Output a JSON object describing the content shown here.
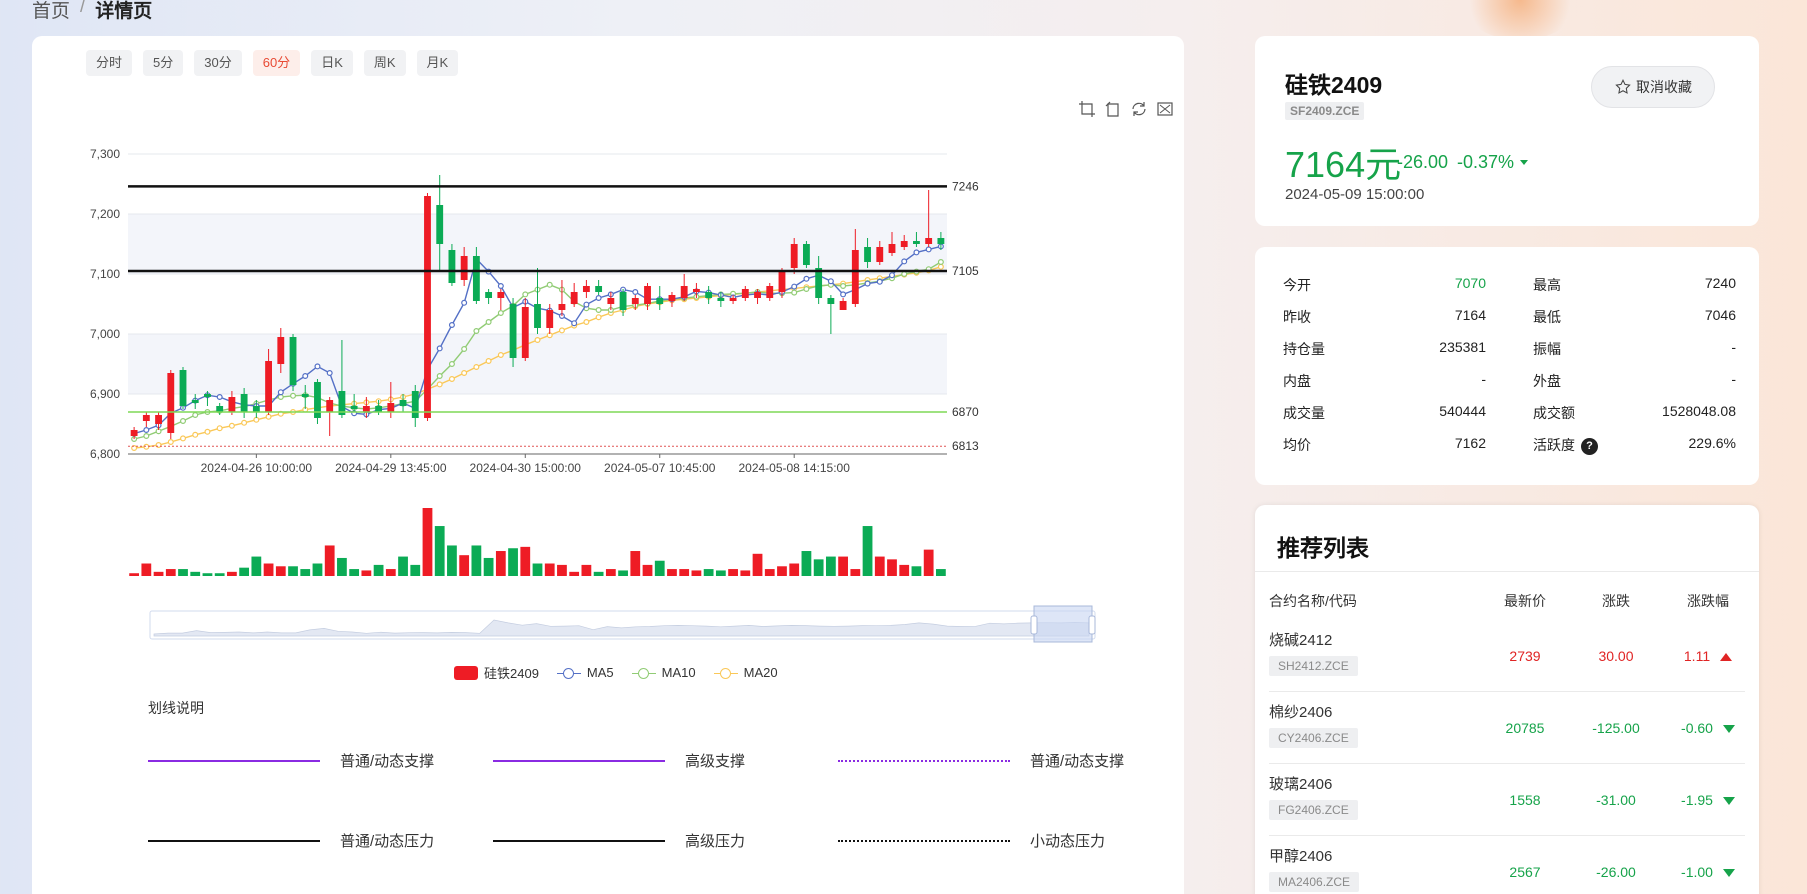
{
  "breadcrumb": {
    "home": "首页",
    "separator": "/",
    "current": "详情页"
  },
  "tabs": [
    {
      "label": "分时",
      "active": false
    },
    {
      "label": "5分",
      "active": false
    },
    {
      "label": "30分",
      "active": false
    },
    {
      "label": "60分",
      "active": true
    },
    {
      "label": "日K",
      "active": false
    },
    {
      "label": "周K",
      "active": false
    },
    {
      "label": "月K",
      "active": false
    }
  ],
  "toolbar_icons": [
    "crop-icon",
    "crop-undo-icon",
    "restore-icon",
    "fullscreen-icon"
  ],
  "quote": {
    "name": "硅铁2409",
    "code": "SF2409.ZCE",
    "price": "7164元",
    "change": "-26.00",
    "change_pct": "-0.37%",
    "time": "2024-05-09 15:00:00",
    "fav_label": "取消收藏"
  },
  "stats": {
    "left": [
      {
        "label": "今开",
        "value": "7070",
        "color": "#16a34a"
      },
      {
        "label": "昨收",
        "value": "7164"
      },
      {
        "label": "持仓量",
        "value": "235381"
      },
      {
        "label": "内盘",
        "value": "-"
      },
      {
        "label": "成交量",
        "value": "540444"
      },
      {
        "label": "均价",
        "value": "7162"
      }
    ],
    "right": [
      {
        "label": "最高",
        "value": "7240"
      },
      {
        "label": "最低",
        "value": "7046"
      },
      {
        "label": "振幅",
        "value": "-"
      },
      {
        "label": "外盘",
        "value": "-"
      },
      {
        "label": "成交额",
        "value": "1528048.08"
      },
      {
        "label": "活跃度",
        "value": "229.6%",
        "help": "?"
      }
    ]
  },
  "recommend": {
    "title": "推荐列表",
    "headers": {
      "name": "合约名称/代码",
      "price": "最新价",
      "change": "涨跌",
      "pct": "涨跌幅"
    },
    "rows": [
      {
        "name": "烧碱2412",
        "code": "SH2412.ZCE",
        "price": "2739",
        "change": "30.00",
        "pct": "1.11",
        "dir": "up"
      },
      {
        "name": "棉纱2406",
        "code": "CY2406.ZCE",
        "price": "20785",
        "change": "-125.00",
        "pct": "-0.60",
        "dir": "down"
      },
      {
        "name": "玻璃2406",
        "code": "FG2406.ZCE",
        "price": "1558",
        "change": "-31.00",
        "pct": "-1.95",
        "dir": "down"
      },
      {
        "name": "甲醇2406",
        "code": "MA2406.ZCE",
        "price": "2567",
        "change": "-26.00",
        "pct": "-1.00",
        "dir": "down"
      }
    ]
  },
  "legend": {
    "candle": "硅铁2409",
    "ma5": "MA5",
    "ma10": "MA10",
    "ma20": "MA20",
    "colors": {
      "ma5": "#5470c6",
      "ma10": "#91cc75",
      "ma20": "#fac858",
      "up": "#ee1c25",
      "down": "#0bab55"
    }
  },
  "line_legend": {
    "title": "划线说明",
    "items": [
      {
        "label": "普通/动态支撑",
        "style": "solid-purple"
      },
      {
        "label": "高级支撑",
        "style": "solid-purple"
      },
      {
        "label": "普通/动态支撑",
        "style": "dot-purple"
      },
      {
        "label": "普通/动态压力",
        "style": "solid-black"
      },
      {
        "label": "高级压力",
        "style": "solid-black"
      },
      {
        "label": "小动态压力",
        "style": "dot-black"
      }
    ]
  },
  "chart_data": {
    "type": "candlestick",
    "ylim": [
      6800,
      7300
    ],
    "y_ticks": [
      "6,800",
      "6,900",
      "7,000",
      "7,100",
      "7,200",
      "7,300"
    ],
    "x_tick_labels": [
      {
        "index": 10,
        "label": "2024-04-26 10:00:00"
      },
      {
        "index": 21,
        "label": "2024-04-29 13:45:00"
      },
      {
        "index": 32,
        "label": "2024-04-30 15:00:00"
      },
      {
        "index": 43,
        "label": "2024-05-07 10:45:00"
      },
      {
        "index": 54,
        "label": "2024-05-08 14:15:00"
      }
    ],
    "hlines": [
      {
        "value": 7246,
        "label": "7246",
        "color": "#111",
        "width": 2.5
      },
      {
        "value": 7105,
        "label": "7105",
        "color": "#111",
        "width": 2.5
      },
      {
        "value": 6870,
        "label": "6870",
        "color": "#7ed957",
        "width": 1.5
      },
      {
        "value": 6813,
        "label": "6813",
        "color": "#e05555",
        "width": 1,
        "dash": true
      }
    ],
    "candles": [
      [
        6830,
        6840,
        6825,
        6845
      ],
      [
        6855,
        6865,
        6845,
        6870
      ],
      [
        6850,
        6865,
        6840,
        6870
      ],
      [
        6835,
        6935,
        6825,
        6940
      ],
      [
        6940,
        6880,
        6875,
        6945
      ],
      [
        6890,
        6885,
        6875,
        6900
      ],
      [
        6900,
        6895,
        6880,
        6905
      ],
      [
        6880,
        6870,
        6865,
        6885
      ],
      [
        6870,
        6895,
        6865,
        6905
      ],
      [
        6900,
        6870,
        6860,
        6910
      ],
      [
        6880,
        6870,
        6860,
        6890
      ],
      [
        6870,
        6955,
        6865,
        6975
      ],
      [
        6950,
        6995,
        6935,
        7010
      ],
      [
        6995,
        6915,
        6905,
        7000
      ],
      [
        6900,
        6895,
        6875,
        6915
      ],
      [
        6920,
        6860,
        6850,
        6925
      ],
      [
        6870,
        6890,
        6830,
        6895
      ],
      [
        6905,
        6865,
        6860,
        6990
      ],
      [
        6880,
        6875,
        6870,
        6900
      ],
      [
        6870,
        6880,
        6860,
        6895
      ],
      [
        6880,
        6870,
        6865,
        6890
      ],
      [
        6870,
        6885,
        6860,
        6920
      ],
      [
        6890,
        6880,
        6870,
        6900
      ],
      [
        6905,
        6860,
        6845,
        6915
      ],
      [
        6860,
        7230,
        6855,
        7235
      ],
      [
        7215,
        7150,
        7105,
        7265
      ],
      [
        7140,
        7085,
        7080,
        7150
      ],
      [
        7090,
        7130,
        7080,
        7145
      ],
      [
        7130,
        7055,
        7050,
        7145
      ],
      [
        7070,
        7060,
        7050,
        7075
      ],
      [
        7060,
        7070,
        7040,
        7075
      ],
      [
        7050,
        6960,
        6945,
        7060
      ],
      [
        6960,
        7045,
        6955,
        7060
      ],
      [
        7050,
        7010,
        7000,
        7110
      ],
      [
        7010,
        7040,
        7000,
        7050
      ],
      [
        7040,
        7050,
        7030,
        7090
      ],
      [
        7050,
        7070,
        7045,
        7085
      ],
      [
        7070,
        7080,
        7060,
        7090
      ],
      [
        7080,
        7070,
        7065,
        7090
      ],
      [
        7050,
        7060,
        7040,
        7070
      ],
      [
        7070,
        7040,
        7030,
        7075
      ],
      [
        7050,
        7060,
        7040,
        7065
      ],
      [
        7050,
        7080,
        7040,
        7085
      ],
      [
        7060,
        7050,
        7040,
        7080
      ],
      [
        7055,
        7065,
        7045,
        7070
      ],
      [
        7060,
        7080,
        7055,
        7100
      ],
      [
        7070,
        7075,
        7060,
        7085
      ],
      [
        7070,
        7060,
        7050,
        7080
      ],
      [
        7060,
        7055,
        7045,
        7070
      ],
      [
        7055,
        7060,
        7050,
        7065
      ],
      [
        7060,
        7075,
        7055,
        7080
      ],
      [
        7060,
        7070,
        7050,
        7075
      ],
      [
        7060,
        7080,
        7055,
        7085
      ],
      [
        7070,
        7105,
        7060,
        7110
      ],
      [
        7110,
        7150,
        7100,
        7160
      ],
      [
        7150,
        7115,
        7110,
        7155
      ],
      [
        7110,
        7060,
        7050,
        7130
      ],
      [
        7060,
        7050,
        7000,
        7065
      ],
      [
        7040,
        7055,
        7040,
        7060
      ],
      [
        7050,
        7140,
        7045,
        7175
      ],
      [
        7145,
        7120,
        7110,
        7160
      ],
      [
        7120,
        7145,
        7115,
        7155
      ],
      [
        7135,
        7150,
        7130,
        7170
      ],
      [
        7145,
        7155,
        7140,
        7165
      ],
      [
        7155,
        7150,
        7145,
        7170
      ],
      [
        7150,
        7160,
        7145,
        7240
      ],
      [
        7160,
        7150,
        7140,
        7170
      ]
    ],
    "ma5": [
      6834,
      6840,
      6848,
      6868,
      6877,
      6889,
      6898,
      6895,
      6887,
      6882,
      6880,
      6880,
      6903,
      6917,
      6930,
      6946,
      6935,
      6879,
      6868,
      6866,
      6874,
      6876,
      6885,
      6876,
      6941,
      6976,
      7015,
      7052,
      7125,
      7104,
      7080,
      7044,
      7054,
      7043,
      7039,
      7030,
      7018,
      7049,
      7060,
      7066,
      7074,
      7070,
      7058,
      7058,
      7058,
      7062,
      7071,
      7069,
      7065,
      7061,
      7065,
      7067,
      7065,
      7070,
      7079,
      7092,
      7098,
      7088,
      7066,
      7074,
      7084,
      7087,
      7098,
      7121,
      7136,
      7141,
      7146
    ],
    "ma10": [
      6825,
      6830,
      6838,
      6846,
      6855,
      6865,
      6870,
      6872,
      6876,
      6879,
      6884,
      6890,
      6895,
      6897,
      6898,
      6894,
      6885,
      6880,
      6877,
      6875,
      6877,
      6880,
      6884,
      6888,
      6908,
      6930,
      6950,
      6975,
      7005,
      7020,
      7035,
      7047,
      7066,
      7074,
      7082,
      7074,
      7054,
      7043,
      7040,
      7040,
      7046,
      7048,
      7051,
      7055,
      7058,
      7060,
      7062,
      7064,
      7066,
      7067,
      7068,
      7070,
      7068,
      7068,
      7069,
      7075,
      7080,
      7082,
      7080,
      7082,
      7085,
      7088,
      7093,
      7100,
      7104,
      7108,
      7120
    ],
    "ma20": [
      6810,
      6812,
      6815,
      6820,
      6826,
      6832,
      6837,
      6843,
      6847,
      6852,
      6857,
      6862,
      6867,
      6870,
      6874,
      6877,
      6880,
      6882,
      6884,
      6886,
      6888,
      6891,
      6895,
      6900,
      6908,
      6916,
      6925,
      6935,
      6945,
      6955,
      6965,
      6973,
      6982,
      6990,
      6998,
      7006,
      7014,
      7020,
      7028,
      7035,
      7040,
      7046,
      7050,
      7053,
      7056,
      7058,
      7060,
      7062,
      7064,
      7066,
      7068,
      7070,
      7072,
      7074,
      7076,
      7078,
      7080,
      7082,
      7084,
      7087,
      7090,
      7093,
      7096,
      7099,
      7102,
      7106,
      7112
    ],
    "volume": [
      2,
      9,
      3,
      5,
      5,
      3,
      2,
      2,
      3,
      6,
      14,
      9,
      7,
      7,
      5,
      9,
      22,
      13,
      5,
      4,
      8,
      5,
      14,
      8,
      49,
      36,
      22,
      15,
      22,
      13,
      18,
      20,
      21,
      9,
      9,
      8,
      3,
      8,
      3,
      5,
      4,
      18,
      8,
      11,
      5,
      5,
      4,
      5,
      4,
      5,
      4,
      16,
      5,
      7,
      9,
      18,
      12,
      14,
      14,
      5,
      36,
      14,
      12,
      8,
      7,
      19,
      5
    ]
  }
}
